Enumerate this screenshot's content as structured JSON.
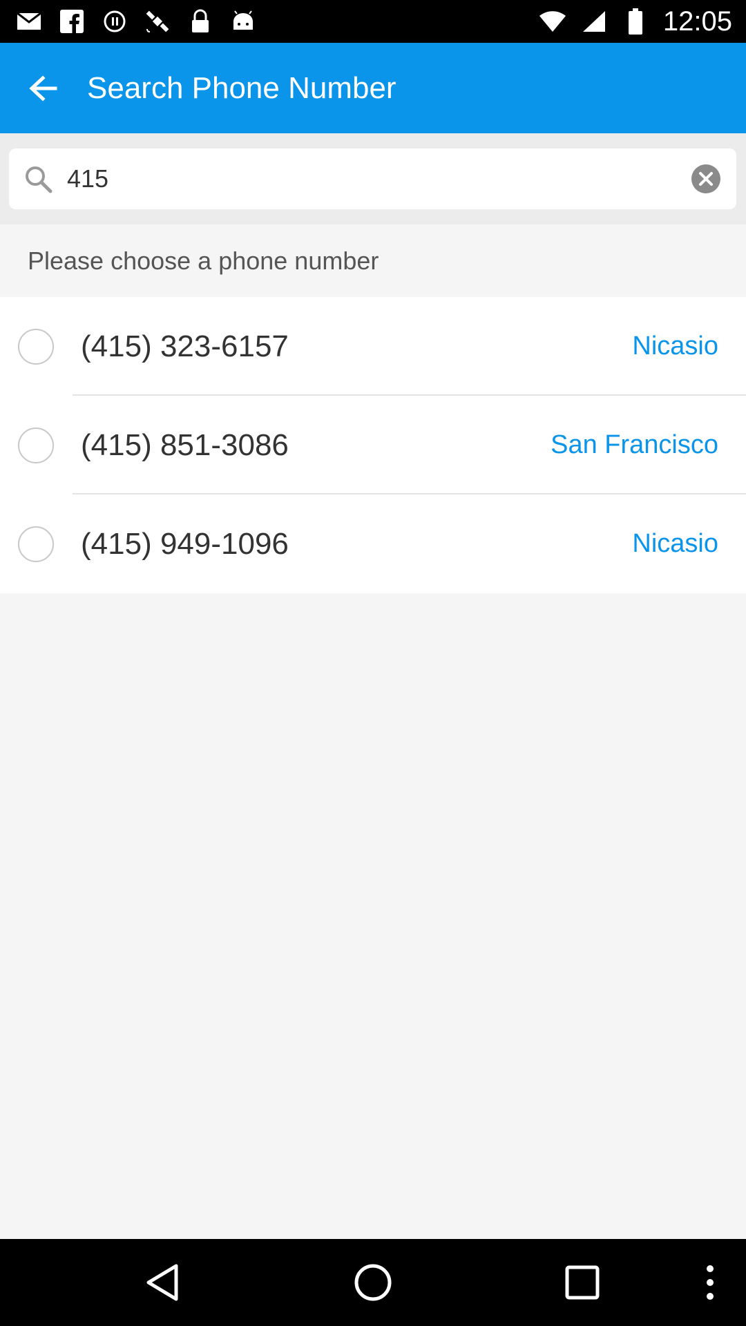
{
  "status_bar": {
    "time": "12:05",
    "icons": [
      "mail-icon",
      "facebook-icon",
      "sync-icon",
      "satellite-icon",
      "lock-icon",
      "android-icon",
      "wifi-icon",
      "signal-icon",
      "battery-icon"
    ]
  },
  "app_bar": {
    "title": "Search Phone Number",
    "back_icon": "arrow-left-icon"
  },
  "search": {
    "value": "415",
    "search_icon": "search-icon",
    "clear_icon": "clear-circle-icon"
  },
  "section": {
    "header": "Please choose a phone number"
  },
  "numbers": [
    {
      "phone": "(415) 323-6157",
      "city": "Nicasio",
      "selected": false
    },
    {
      "phone": "(415) 851-3086",
      "city": "San Francisco",
      "selected": false
    },
    {
      "phone": "(415) 949-1096",
      "city": "Nicasio",
      "selected": false
    }
  ],
  "nav_bar": {
    "icons": [
      "back-triangle-icon",
      "home-circle-icon",
      "recents-square-icon",
      "more-vert-icon"
    ]
  },
  "colors": {
    "accent": "#0a94ea",
    "background": "#f5f5f5"
  }
}
